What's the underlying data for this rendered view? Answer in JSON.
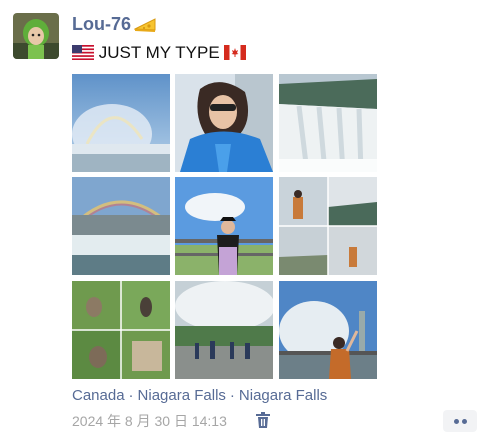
{
  "post": {
    "username": "Lou-76",
    "caption": "JUST MY TYPE",
    "location_parts": [
      "Canada",
      "Niagara Falls",
      "Niagara Falls"
    ],
    "timestamp": "2024 年 8 月 30 日 14:13"
  },
  "icons": {
    "username_badge": "cheese-wedge-icon",
    "caption_left": "us-flag-icon",
    "caption_right": "canada-flag-icon",
    "delete": "trash-icon",
    "more": "more-dots-icon"
  },
  "colors": {
    "name_link": "#576b95",
    "time_gray": "#a6a6a6"
  }
}
